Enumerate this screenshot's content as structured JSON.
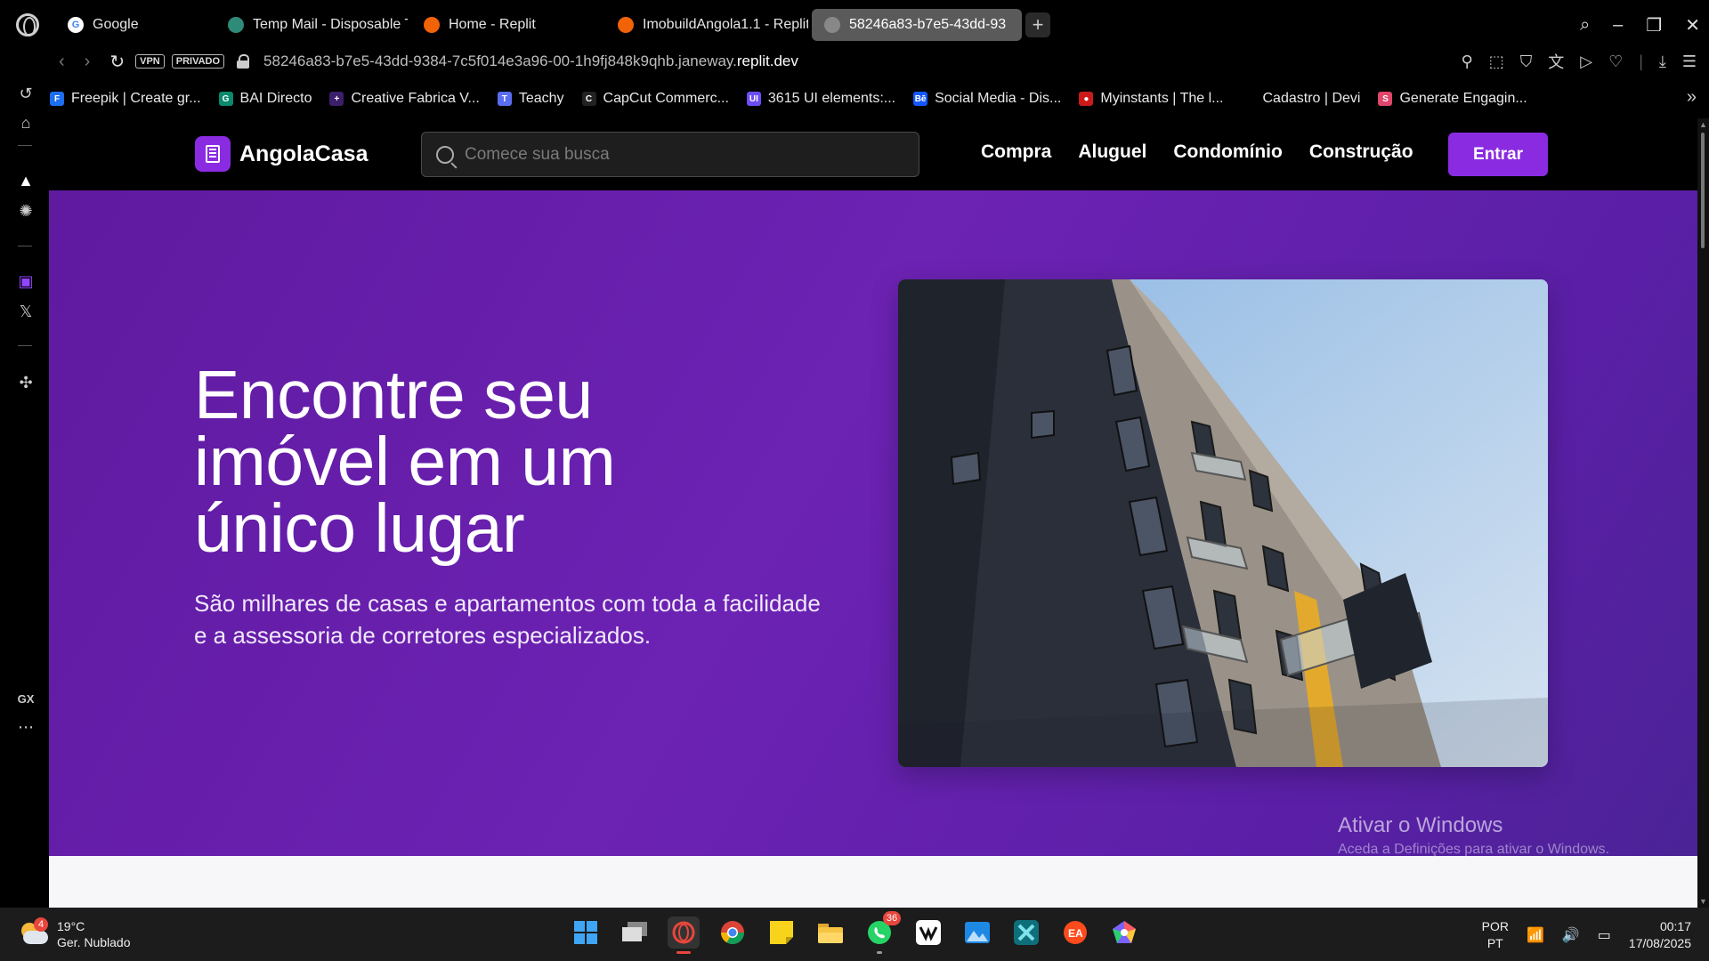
{
  "browser": {
    "tabs": [
      {
        "label": "Google",
        "fav_color": "#ffffff",
        "fav_text": "G",
        "fav_fg": "#4285f4",
        "active": false
      },
      {
        "label": "Temp Mail - Disposable T",
        "fav_color": "#2e8b7a",
        "fav_text": "",
        "fav_fg": "#fff",
        "active": false
      },
      {
        "label": "Home - Replit",
        "fav_color": "#f26207",
        "fav_text": "",
        "fav_fg": "#fff",
        "active": false
      },
      {
        "label": "ImobuildAngola1.1 - Replit",
        "fav_color": "#f26207",
        "fav_text": "",
        "fav_fg": "#fff",
        "active": false
      },
      {
        "label": "58246a83-b7e5-43dd-93",
        "fav_color": "#888888",
        "fav_text": "",
        "fav_fg": "#fff",
        "active": true
      }
    ],
    "vpn_label": "VPN",
    "private_label": "PRIVADO",
    "url_prefix": "58246a83-b7e5-43dd-9384-7c5f014e3a96-00-1h9fj848k9qhb.janeway.",
    "url_domain": "replit.dev",
    "bookmarks": [
      {
        "label": "Freepik | Create gr...",
        "color": "#1d6ef0",
        "glyph": "F"
      },
      {
        "label": "BAI Directo",
        "color": "#0a8a6c",
        "glyph": "G"
      },
      {
        "label": "Creative Fabrica V...",
        "color": "#3b1f6b",
        "glyph": "+"
      },
      {
        "label": "Teachy",
        "color": "#5a6df0",
        "glyph": "T"
      },
      {
        "label": "CapCut Commerc...",
        "color": "#222222",
        "glyph": "C"
      },
      {
        "label": "3615 UI elements:...",
        "color": "#6c4df5",
        "glyph": "UI"
      },
      {
        "label": "Social Media - Dis...",
        "color": "#1357ff",
        "glyph": "Bē"
      },
      {
        "label": "Myinstants | The l...",
        "color": "#cc1a1a",
        "glyph": "●"
      },
      {
        "label": "Cadastro | Devi",
        "color": "#000000",
        "glyph": ""
      },
      {
        "label": "Generate Engagin...",
        "color": "#e0456b",
        "glyph": "S"
      }
    ],
    "sidebar_gx": "GX"
  },
  "site": {
    "brand": "AngolaCasa",
    "search_placeholder": "Comece sua busca",
    "nav": [
      "Compra",
      "Aluguel",
      "Condomínio",
      "Construção"
    ],
    "cta": "Entrar",
    "accent": "#8a2be2",
    "hero": {
      "title": "Encontre seu imóvel em um único lugar",
      "subtitle": "São milhares de casas e apartamentos com toda a facilidade e a assessoria de corretores especializados."
    }
  },
  "watermark": {
    "line1": "Ativar o Windows",
    "line2": "Aceda a Definições para ativar o Windows."
  },
  "taskbar": {
    "weather_badge": "4",
    "temperature": "19°C",
    "condition": "Ger. Nublado",
    "whatsapp_count": "36",
    "lang_top": "POR",
    "lang_bottom": "PT",
    "time": "00:17",
    "date": "17/08/2025"
  }
}
